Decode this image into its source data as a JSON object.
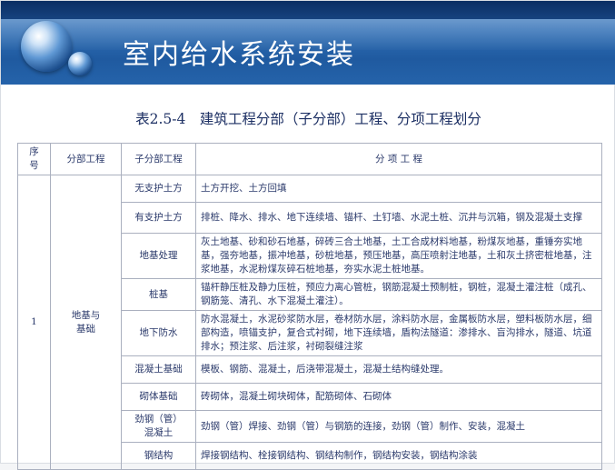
{
  "header": {
    "title": "室内给水系统安装"
  },
  "table_caption": "表2.5-4　建筑工程分部（子分部）工程、分项工程划分",
  "table": {
    "headers": {
      "seq": "序\n号",
      "division": "分部工程",
      "subdivision": "子分部工程",
      "items": "分 项 工 程"
    },
    "seq_value": "1",
    "division_value": "地基与\n基础",
    "rows": [
      {
        "sub": "无支护土方",
        "items": "土方开挖、土方回填"
      },
      {
        "sub": "有支护土方",
        "items": "排桩、降水、排水、地下连续墙、锚杆、土钉墙、水泥土桩、沉井与沉箱，钢及混凝土支撑"
      },
      {
        "sub": "地基处理",
        "items": "灰土地基、砂和砂石地基，碎砖三合土地基，土工合成材料地基，粉煤灰地基，重锤夯实地基，强夯地基，振冲地基，砂桩地基，预压地基，高压喷射注地基，土和灰土挤密桩地基，注浆地基，水泥粉煤灰碎石桩地基，夯实水泥土桩地基。"
      },
      {
        "sub": "桩基",
        "items": "锚杆静压桩及静力压桩，预应力离心管桩，钢筋混凝土预制桩，钢桩，混凝土灌注桩（成孔、钢筋笼、清孔、水下混凝土灌注）。"
      },
      {
        "sub": "地下防水",
        "items": "防水混凝土，水泥砂浆防水层，卷材防水层，涂料防水层，金属板防水层，塑料板防水层，细部构造，喷锚支护，复合式衬砌，地下连续墙，盾构法隧道：渗排水、盲沟排水，隧道、坑道排水；预注浆、后注浆，衬砌裂缝注浆"
      },
      {
        "sub": "混凝土基础",
        "items": "模板、钢筋、混凝土，后浇带混凝土，混凝土结构缝处理。"
      },
      {
        "sub": "砌体基础",
        "items": "砖砌体，混凝土砌块砌体，配筋砌体、石砌体"
      },
      {
        "sub": "劲钢（管）\n混凝土",
        "items": "劲钢（管）焊接、劲钢（管）与钢筋的连接，劲钢（管）制作、安装，混凝土"
      },
      {
        "sub": "钢结构",
        "items": "焊接钢结构、栓接钢结构、钢结构制作，钢结构安装，钢结构涂装"
      }
    ]
  }
}
